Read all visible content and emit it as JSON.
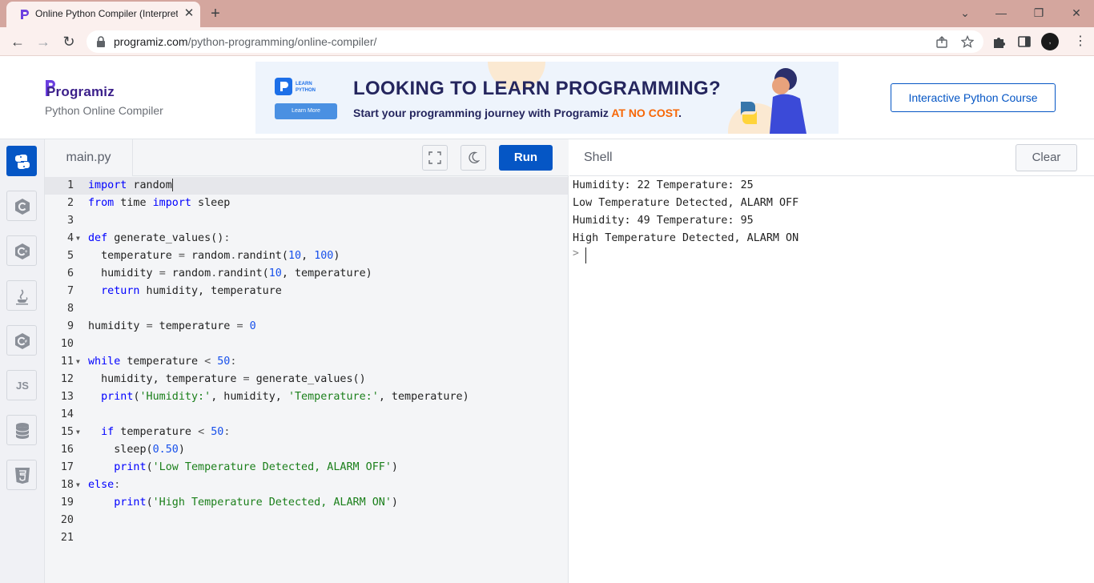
{
  "browser": {
    "tab_title": "Online Python Compiler (Interpreter)",
    "url_host": "programiz.com",
    "url_path": "/python-programming/online-compiler/",
    "avatar_initial": ","
  },
  "header": {
    "logo_text": "Programiz",
    "subtitle": "Python Online Compiler",
    "banner": {
      "badge_text": "LEARN PYTHON",
      "learn_more": "Learn More",
      "headline": "LOOKING TO LEARN PROGRAMMING?",
      "sub_prefix": "Start your programming journey with Programiz ",
      "sub_accent": "AT NO COST",
      "sub_suffix": "."
    },
    "course_button": "Interactive Python Course"
  },
  "sidebar": {
    "languages": [
      "python",
      "c",
      "cpp",
      "java",
      "csharp",
      "js",
      "sql",
      "html"
    ],
    "js_label": "JS"
  },
  "editor": {
    "filename": "main.py",
    "run_label": "Run",
    "current_line": 1
  },
  "shell": {
    "title": "Shell",
    "clear_label": "Clear",
    "output": [
      "Humidity: 22 Temperature: 25",
      "Low Temperature Detected, ALARM OFF",
      "Humidity: 49 Temperature: 95",
      "High Temperature Detected, ALARM ON"
    ],
    "prompt": ">"
  },
  "colors": {
    "brand_blue": "#0556c5",
    "accent_orange": "#f76707",
    "tab_bar": "#d4a69e"
  },
  "code_lines": [
    "import random",
    "from time import sleep",
    "",
    "def generate_values():",
    "  temperature = random.randint(10, 100)",
    "  humidity = random.randint(10, temperature)",
    "  return humidity, temperature",
    "",
    "humidity = temperature = 0",
    "",
    "while temperature < 50:",
    "  humidity, temperature = generate_values()",
    "  print('Humidity:', humidity, 'Temperature:', temperature)",
    "",
    "  if temperature < 50:",
    "    sleep(0.50)",
    "    print('Low Temperature Detected, ALARM OFF')",
    "else:",
    "    print('High Temperature Detected, ALARM ON')",
    "",
    ""
  ],
  "line_numbers": [
    "1",
    "2",
    "3",
    "4",
    "5",
    "6",
    "7",
    "8",
    "9",
    "10",
    "11",
    "12",
    "13",
    "14",
    "15",
    "16",
    "17",
    "18",
    "19",
    "20",
    "21"
  ],
  "fold_lines": [
    4,
    11,
    15,
    18
  ]
}
